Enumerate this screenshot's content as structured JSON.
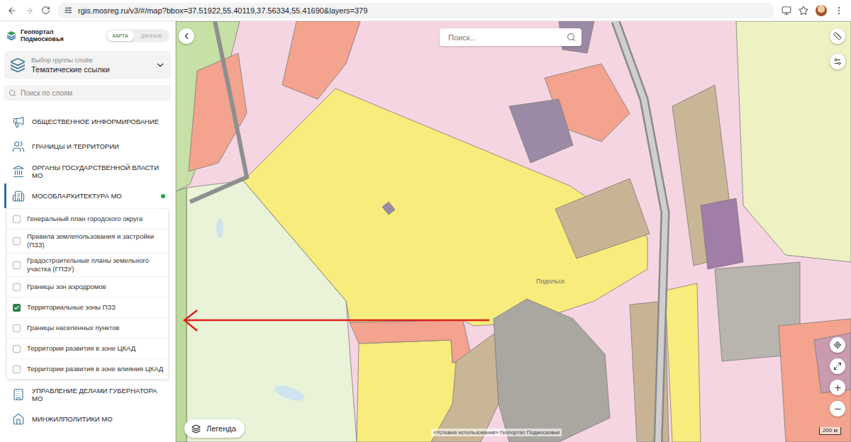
{
  "browser": {
    "url": "rgis.mosreg.ru/v3/#/map?bbox=37.51922,55.40119,37.56334,55.41690&layers=379"
  },
  "sidebar": {
    "logo_lines": [
      "Геопортал",
      "Подмосковья"
    ],
    "view_toggle": [
      {
        "label": "КАРТА",
        "selected": true
      },
      {
        "label": "ДАННЫЕ",
        "selected": false
      }
    ],
    "group_select": {
      "caption": "Выбор группы слоёв",
      "value": "Тематические ссылки"
    },
    "layer_search": {
      "placeholder": "Поиск по слоям"
    },
    "categories": [
      {
        "label": "ОБЩЕСТВЕННОЕ ИНФОРМИРОВАНИЕ",
        "expanded": false,
        "has_active_layers": false,
        "layers": []
      },
      {
        "label": "ГРАНИЦЫ И ТЕРРИТОРИИ",
        "expanded": false,
        "has_active_layers": false,
        "layers": []
      },
      {
        "label": "ОРГАНЫ ГОСУДАРСТВЕННОЙ ВЛАСТИ МО",
        "expanded": false,
        "has_active_layers": false,
        "layers": []
      },
      {
        "label": "МОСОБЛАРХИТЕКТУРА МО",
        "expanded": true,
        "has_active_layers": true,
        "layers": [
          {
            "label": "Генеральный план городского округа",
            "checked": false
          },
          {
            "label": "Правила землепользования и застройки (ПЗЗ)",
            "checked": false
          },
          {
            "label": "Градостроительные планы земельного участка (ГПЗУ)",
            "checked": false
          },
          {
            "label": "Границы зон аэродромов",
            "checked": false
          },
          {
            "label": "Территориальные зоны ПЗЗ",
            "checked": true
          },
          {
            "label": "Границы населенных пунктов",
            "checked": false
          },
          {
            "label": "Территории развития в зоне ЦКАД",
            "checked": false
          },
          {
            "label": "Территории развития в зоне влияния ЦКАД",
            "checked": false
          }
        ]
      },
      {
        "label": "УПРАВЛЕНИЕ ДЕЛАМИ ГУБЕРНАТОРА МО",
        "expanded": false,
        "has_active_layers": false,
        "layers": []
      },
      {
        "label": "МИНЖИЛПОЛИТИКИ МО",
        "expanded": false,
        "has_active_layers": false,
        "layers": []
      }
    ]
  },
  "map": {
    "search_placeholder": "Поиск...",
    "legend_button": "Легенда",
    "attribution": "«Условия использования» Геопортал Подмосковья",
    "scale": "200 м",
    "labels": [
      {
        "text": "Подольск"
      }
    ]
  }
}
